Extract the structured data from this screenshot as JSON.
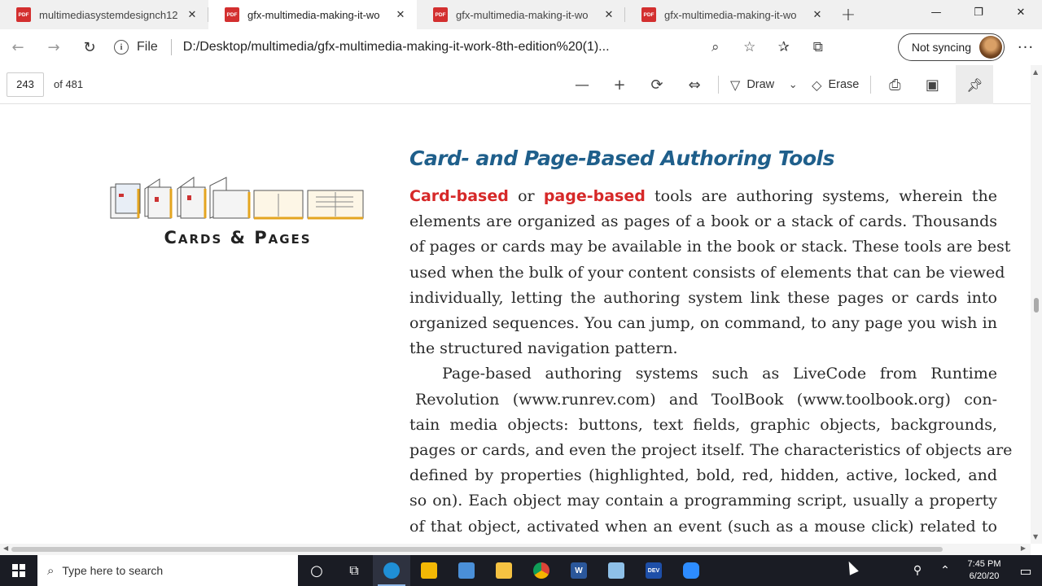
{
  "tabs": [
    {
      "title": "multimediasystemdesignch12",
      "active": false
    },
    {
      "title": "gfx-multimedia-making-it-wo",
      "active": true
    },
    {
      "title": "gfx-multimedia-making-it-wo",
      "active": false
    },
    {
      "title": "gfx-multimedia-making-it-wo",
      "active": false
    }
  ],
  "icons": {
    "pdf_badge": "PDF"
  },
  "address": {
    "scheme_label": "File",
    "url": "D:/Desktop/multimedia/gfx-multimedia-making-it-work-8th-edition%20(1)...",
    "sync_label": "Not syncing"
  },
  "pdf_toolbar": {
    "page_number": "243",
    "page_total": "of 481",
    "draw_label": "Draw",
    "erase_label": "Erase"
  },
  "document": {
    "logo_caption": "Cards & Pages",
    "title": "Card- and Page-Based Authoring Tools",
    "highlight_card": "Card-based",
    "highlight_or": "or",
    "highlight_page": "page-based",
    "lines": [
      "tools are authoring systems, wherein the",
      "elements are organized as pages of a book or a stack of cards. Thousands",
      "of pages or cards may be available in the book or stack. These tools are best",
      "used when the bulk of your content consists of elements that can be viewed",
      "individually, letting the authoring system link these pages or cards into",
      "organized sequences. You can jump, on command, to any page you wish in",
      "the structured navigation pattern.",
      "Page-based authoring systems such as LiveCode from Runtime",
      "Revolution (www.runrev.com) and ToolBook (www.toolbook.org) con-",
      "tain media objects: buttons, text fields, graphic objects, backgrounds,",
      "pages or cards, and even the project itself. The characteristics of objects are",
      "defined by properties (highlighted, bold, red, hidden, active, locked, and",
      "so on). Each object may contain a programming script, usually a property",
      "of that object, activated when an event (such as a mouse click) related to"
    ]
  },
  "taskbar": {
    "search_placeholder": "Type here to search",
    "time": "7:45 PM",
    "date": "6/20/20",
    "word_label": "W",
    "dev_label": "DEV"
  },
  "colors": {
    "title_blue": "#1f5f8b",
    "highlight_red": "#d62828",
    "taskbar": "#1a1c24"
  }
}
